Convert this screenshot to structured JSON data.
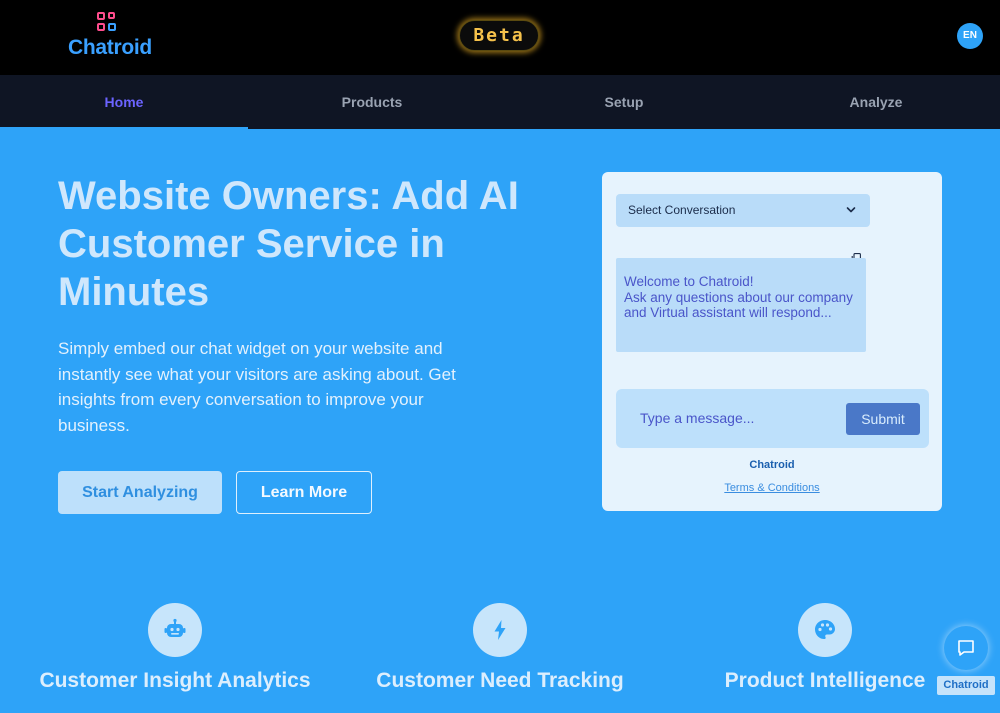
{
  "header": {
    "logo_text": "Chatroid",
    "beta_label": "Beta",
    "language": "EN"
  },
  "nav": {
    "tabs": [
      {
        "label": "Home",
        "active": true
      },
      {
        "label": "Products",
        "active": false
      },
      {
        "label": "Setup",
        "active": false
      },
      {
        "label": "Analyze",
        "active": false
      }
    ]
  },
  "hero": {
    "title": "Website Owners: Add AI Customer Service in Minutes",
    "subtitle": "Simply embed our chat widget on your website and instantly see what your visitors are asking about. Get insights from every conversation to improve your business.",
    "primary_button": "Start Analyzing",
    "secondary_button": "Learn More"
  },
  "widget": {
    "select_label": "Select Conversation",
    "welcome_message": "Welcome to Chatroid!\nAsk any questions about our company and Virtual assistant will respond...",
    "input_placeholder": "Type a message...",
    "submit_label": "Submit",
    "brand": "Chatroid",
    "terms_link": "Terms & Conditions"
  },
  "features": [
    {
      "icon": "robot-icon",
      "title": "Customer Insight Analytics"
    },
    {
      "icon": "lightning-icon",
      "title": "Customer Need Tracking"
    },
    {
      "icon": "palette-icon",
      "title": "Product Intelligence"
    }
  ],
  "chat_fab": {
    "label": "Chatroid"
  },
  "colors": {
    "page_bg": "#2ea3f8",
    "topbar_bg": "#000000",
    "nav_bg": "#0f1524",
    "nav_active": "#6b63ff",
    "beta_text": "#f6c24b"
  }
}
